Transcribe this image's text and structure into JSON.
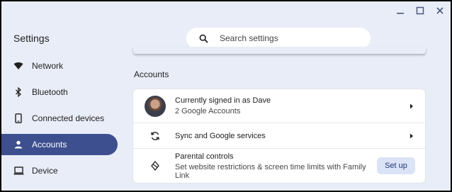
{
  "app": {
    "title": "Settings"
  },
  "search": {
    "placeholder": "Search settings",
    "value": ""
  },
  "sidebar": {
    "items": [
      {
        "label": "Network",
        "icon": "wifi-icon",
        "active": false
      },
      {
        "label": "Bluetooth",
        "icon": "bluetooth-icon",
        "active": false
      },
      {
        "label": "Connected devices",
        "icon": "phone-icon",
        "active": false
      },
      {
        "label": "Accounts",
        "icon": "person-icon",
        "active": true
      },
      {
        "label": "Device",
        "icon": "laptop-icon",
        "active": false
      }
    ]
  },
  "main": {
    "section_title": "Accounts",
    "rows": [
      {
        "primary": "Currently signed in as Dave",
        "secondary": "2 Google Accounts"
      },
      {
        "primary": "Sync and Google services"
      },
      {
        "primary": "Parental controls",
        "secondary": "Set website restrictions & screen time limits with Family Link",
        "button": "Set up"
      }
    ]
  },
  "colors": {
    "accent": "#3d4f8f",
    "background": "#e9edf8",
    "button_bg": "#dbe3f7"
  }
}
